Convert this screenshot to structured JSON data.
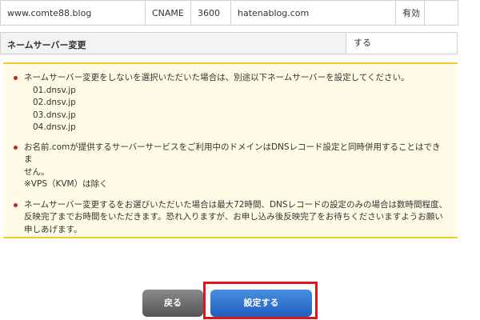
{
  "dns_record": {
    "host": "www.comte88.blog",
    "type": "CNAME",
    "ttl": "3600",
    "value": "hatenablog.com",
    "status": "有効"
  },
  "nameserver_change": {
    "label": "ネームサーバー変更",
    "value": "する"
  },
  "notice": {
    "item1_text": "ネームサーバー変更をしないを選択いただいた場合は、別途以下ネームサーバーを設定してください。",
    "nameservers": [
      "01.dnsv.jp",
      "02.dnsv.jp",
      "03.dnsv.jp",
      "04.dnsv.jp"
    ],
    "item2_line1": "お名前.comが提供するサーバーサービスをご利用中のドメインはDNSレコード設定と同時併用することはできま",
    "item2_line2": "せん。",
    "item2_note": "※VPS（KVM）は除く",
    "item3_line1": "ネームサーバー変更するをお選びいただいた場合は最大72時間、DNSレコードの設定のみの場合は数時間程度、",
    "item3_line2": "反映完了までお時間をいただきます。恐れ入りますが、お申し込み後反映完了をお待ちくださいますようお願い",
    "item3_line3": "申しあげます。"
  },
  "buttons": {
    "back_label": "戻る",
    "submit_label": "設定する"
  },
  "colors": {
    "notice_border": "#f2cd2a",
    "notice_background": "#fffbe6",
    "bullet": "#cc2222",
    "submit_button": "#2a6fd0",
    "back_button": "#6e6e6e",
    "highlight_box": "#e0141e"
  }
}
